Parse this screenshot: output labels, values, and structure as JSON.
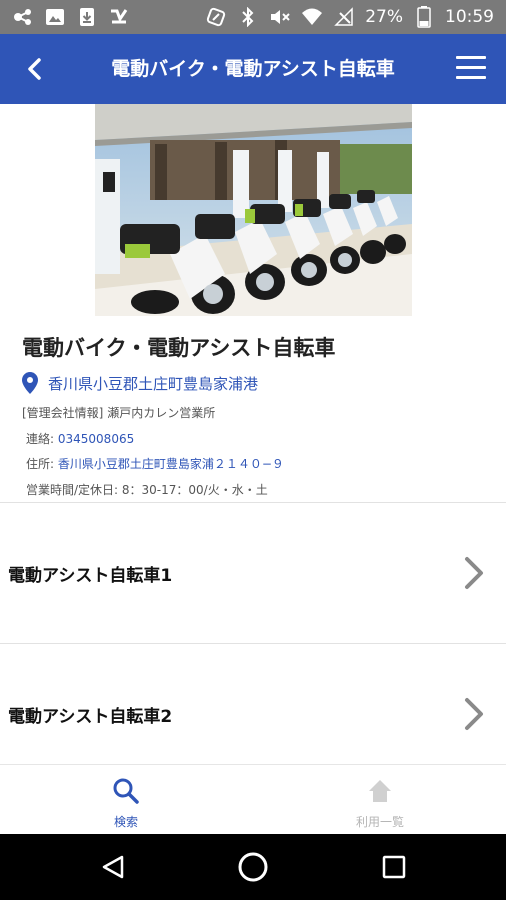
{
  "status_bar": {
    "battery": "27%",
    "time": "10:59",
    "left_icons": [
      "usb-icon",
      "image-icon",
      "download-icon",
      "app-check-icon"
    ],
    "right_icons": [
      "nfc-icon",
      "bluetooth-icon",
      "mute-icon",
      "wifi-icon",
      "no-sim-icon",
      "battery-icon"
    ]
  },
  "app_bar": {
    "title": "電動バイク・電動アシスト自転車",
    "back_icon": "chevron-left-icon",
    "menu_icon": "hamburger-menu-icon"
  },
  "spot": {
    "title": "電動バイク・電動アシスト自転車",
    "address": "香川県小豆郡土庄町豊島家浦港",
    "company_label": "[管理会社情報]",
    "company_name": "瀬戸内カレン営業所",
    "phone_label": "連絡:",
    "phone": "0345008065",
    "address2_label": "住所:",
    "address2": "香川県小豆郡土庄町豊島家浦２１４０−９",
    "hours": "営業時間/定休日: 8：30-17：00/火・水・土"
  },
  "items": [
    {
      "label": "電動アシスト自転車1"
    },
    {
      "label": "電動アシスト自転車2"
    }
  ],
  "bottom_nav": [
    {
      "label": "検索",
      "icon": "search-icon",
      "active": true
    },
    {
      "label": "利用一覧",
      "icon": "home-icon",
      "active": false
    }
  ],
  "colors": {
    "primary": "#2f55b7",
    "status_bar": "#7a7a7a",
    "inactive": "#b5b5b5"
  }
}
